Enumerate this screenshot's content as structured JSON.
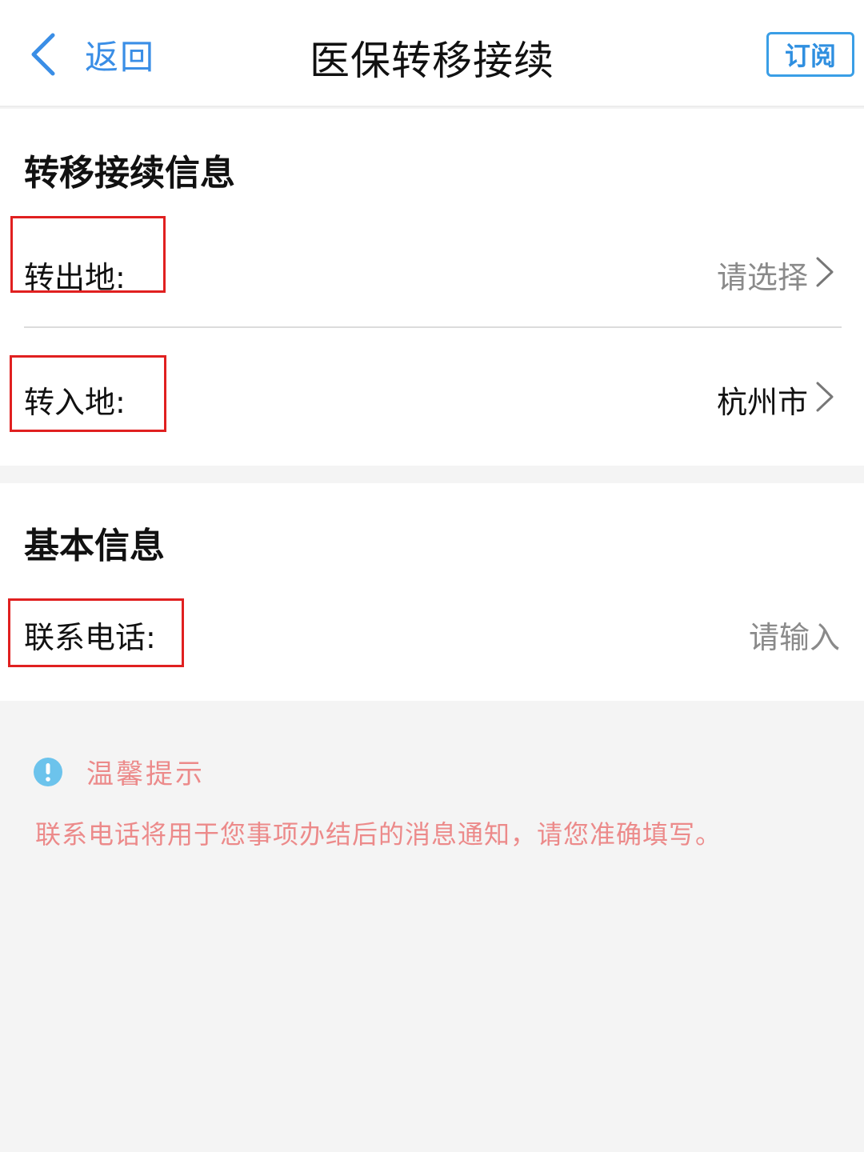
{
  "nav": {
    "back_label": "返回",
    "title": "医保转移接续",
    "subscribe_label": "订阅"
  },
  "transfer_section": {
    "title": "转移接续信息",
    "from": {
      "label": "转出地:",
      "value": "请选择"
    },
    "to": {
      "label": "转入地:",
      "value": "杭州市"
    }
  },
  "basic_section": {
    "title": "基本信息",
    "phone": {
      "label": "联系电话:",
      "placeholder": "请输入"
    }
  },
  "tip": {
    "title": "温馨提示",
    "text": "联系电话将用于您事项办结后的消息通知，请您准确填写。"
  },
  "colors": {
    "accent": "#3a8ee6",
    "tip": "#ec8a8a",
    "highlight": "#e02020",
    "placeholder": "#8a8a8a"
  },
  "icons": {
    "back": "chevron-left-icon",
    "row_arrow": "chevron-right-icon",
    "tip": "exclamation-circle-icon"
  }
}
